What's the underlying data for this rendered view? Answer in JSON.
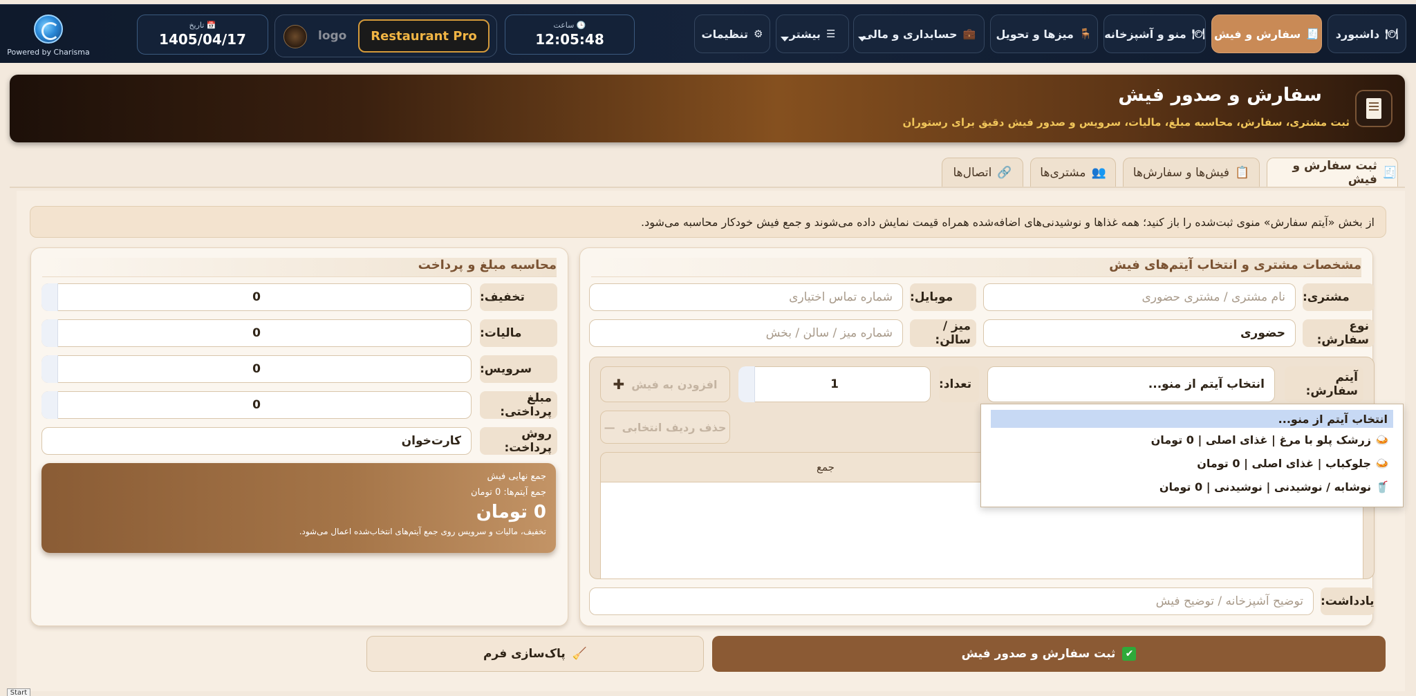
{
  "brand": {
    "powered_by": "Powered by Charisma"
  },
  "nav": {
    "items": [
      {
        "label": "داشبورد",
        "icon": "🍽"
      },
      {
        "label": "سفارش و فیش",
        "icon": "🧾"
      },
      {
        "label": "منو و آشپزخانه",
        "icon": "🍽"
      },
      {
        "label": "میزها و تحویل",
        "icon": "🪑"
      },
      {
        "label": "حسابداری و مالی",
        "icon": "💼"
      },
      {
        "label": "بیشتر",
        "icon": "☰"
      },
      {
        "label": "تنظیمات",
        "icon": "⚙"
      }
    ],
    "active_index": 1
  },
  "clock": {
    "label": "ساعت",
    "value": "12:05:48"
  },
  "restaurant": {
    "logo_text": "logo",
    "button_label": "Restaurant Pro"
  },
  "date": {
    "label": "تاریخ",
    "value": "1405/04/17"
  },
  "hero": {
    "title": "سفارش و صدور فیش",
    "subtitle": "ثبت مشتری، سفارش، محاسبه مبلغ، مالیات، سرویس و صدور فیش دقیق برای رستوران"
  },
  "tabs": [
    {
      "label": "ثبت سفارش و فیش",
      "icon": "🧾"
    },
    {
      "label": "فیش‌ها و سفارش‌ها",
      "icon": "📋"
    },
    {
      "label": "مشتری‌ها",
      "icon": "👥"
    },
    {
      "label": "اتصال‌ها",
      "icon": "🔗"
    }
  ],
  "notice": "از بخش «آیتم سفارش» منوی ثبت‌شده را باز کنید؛ همه غذاها و نوشیدنی‌های اضافه‌شده همراه قیمت نمایش داده می‌شوند و جمع فیش خودکار محاسبه می‌شود.",
  "customer_panel": {
    "title": "مشخصات مشتری و انتخاب آیتم‌های فیش",
    "customer_label": "مشتری:",
    "customer_placeholder": "نام مشتری / مشتری حضوری",
    "mobile_label": "موبایل:",
    "mobile_placeholder": "شماره تماس اختیاری",
    "order_type_label": "نوع سفارش:",
    "order_type_value": "حضوری",
    "table_label": "میز / سالن:",
    "table_placeholder": "شماره میز / سالن / بخش",
    "item_label": "آیتم سفارش:",
    "item_value": "انتخاب آیتم از منو...",
    "qty_label": "تعداد:",
    "qty_value": "1",
    "add_button": "افزودن به فیش",
    "remove_button": "حذف ردیف انتخابی",
    "table_sum_header": "جمع",
    "note_label": "یادداشت:",
    "note_placeholder": "توضیح آشپزخانه / توضیح فیش"
  },
  "dropdown": {
    "options": [
      {
        "icon": "",
        "text": "انتخاب آیتم از منو..."
      },
      {
        "icon": "🍛",
        "text": "زرشک پلو با مرغ  |  غذای اصلی  |  0 تومان"
      },
      {
        "icon": "🍛",
        "text": "جلوکباب  |  غذای اصلی  |  0 تومان"
      },
      {
        "icon": "🥤",
        "text": "نوشابه / نوشیدنی  |  نوشیدنی  |  0 تومان"
      }
    ]
  },
  "payment_panel": {
    "title": "محاسبه مبلغ و پرداخت",
    "discount_label": "تخفیف:",
    "discount_value": "0",
    "tax_label": "مالیات:",
    "tax_value": "0",
    "service_label": "سرویس:",
    "service_value": "0",
    "payable_label": "مبلغ پرداختی:",
    "payable_value": "0",
    "method_label": "روش پرداخت:",
    "method_value": "کارت‌خوان"
  },
  "summary": {
    "title": "جمع نهایی فیش",
    "items_total": "جمع آیتم‌ها: 0 تومان",
    "grand_total": "0 تومان",
    "note": "تخفیف، مالیات و سرویس روی جمع آیتم‌های انتخاب‌شده اعمال می‌شود."
  },
  "actions": {
    "submit_label": "ثبت سفارش و صدور فیش",
    "clear_label": "پاک‌سازی فرم"
  },
  "taskbar": {
    "start_label": "Start"
  }
}
